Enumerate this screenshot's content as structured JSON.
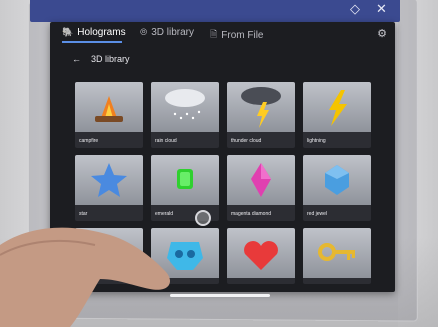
{
  "window": {
    "pin_icon": "◇",
    "close_icon": "✕"
  },
  "tabs": [
    {
      "label": "Holograms",
      "icon": "🐘",
      "active": true
    },
    {
      "label": "3D library",
      "icon": "⦾",
      "active": false
    },
    {
      "label": "From File",
      "icon": "🗎",
      "active": false
    }
  ],
  "settings_icon": "⚙",
  "subhead": {
    "back_icon": "←",
    "title": "3D library"
  },
  "items": [
    {
      "label": "campfire"
    },
    {
      "label": "rain cloud"
    },
    {
      "label": "thunder cloud"
    },
    {
      "label": "lightning"
    },
    {
      "label": "star"
    },
    {
      "label": "emerald"
    },
    {
      "label": "magenta diamond"
    },
    {
      "label": "red jewel"
    },
    {
      "label": ""
    },
    {
      "label": ""
    },
    {
      "label": ""
    },
    {
      "label": ""
    }
  ]
}
